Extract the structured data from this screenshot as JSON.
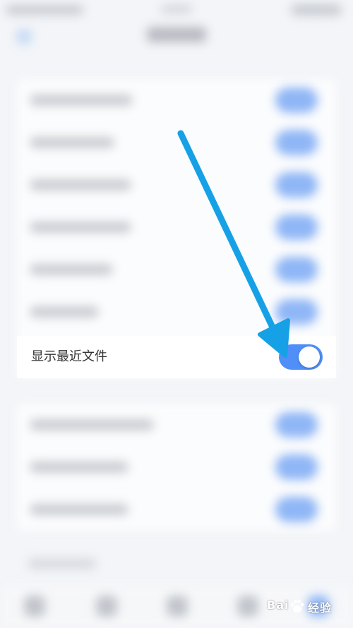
{
  "setting_row": {
    "label": "显示最近文件",
    "enabled": true
  },
  "colors": {
    "toggle_on": "#4f8ff7",
    "annotation_arrow": "#16a1e6",
    "background": "#f3f5f8"
  },
  "watermark": {
    "brand_prefix": "Bai",
    "brand_suffix": "经验",
    "logo_icon": "baidu-paw-icon"
  }
}
